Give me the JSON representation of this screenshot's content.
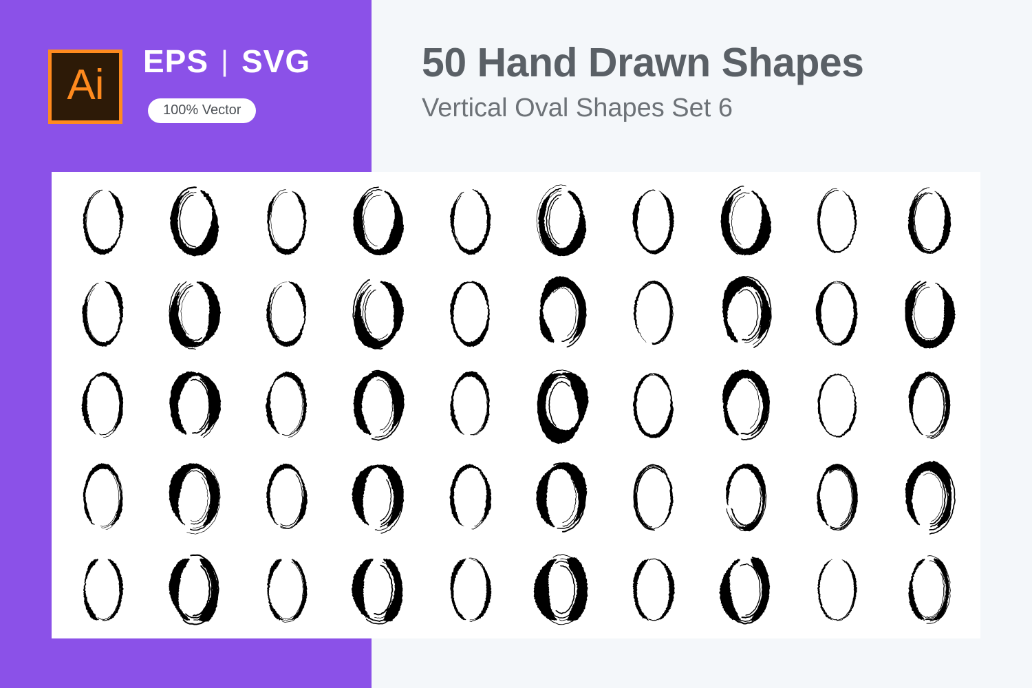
{
  "poster": {
    "colors": {
      "purple": "#8b51e8",
      "page_background": "#f4f7fa",
      "panel_background": "#ffffff",
      "title_gray": "#5a6066",
      "subtitle_gray": "#6d7277",
      "logo_orange": "#ff8a1e",
      "logo_dark": "#2d1a07",
      "shape_black": "#000000"
    }
  },
  "badge": {
    "logo_text": "Ai",
    "format_primary": "EPS",
    "format_separator": "|",
    "format_secondary": "SVG",
    "vector_pill": "100% Vector"
  },
  "heading": {
    "title": "50 Hand Drawn Shapes",
    "subtitle": "Vertical Oval Shapes Set 6"
  },
  "shapes": {
    "count": 50,
    "columns": 10,
    "rows": 5,
    "kind": "hand-drawn-brush-oval",
    "items": [
      {
        "id": 1,
        "style": "thin",
        "gap": "right",
        "tail": "light"
      },
      {
        "id": 2,
        "style": "bold",
        "gap": "right",
        "tail": "heavy"
      },
      {
        "id": 3,
        "style": "thin",
        "gap": "right",
        "tail": "wispy"
      },
      {
        "id": 4,
        "style": "bold",
        "gap": "right",
        "tail": "heavy"
      },
      {
        "id": 5,
        "style": "thin",
        "gap": "bottom-right",
        "tail": "wispy"
      },
      {
        "id": 6,
        "style": "bold",
        "gap": "right",
        "tail": "double"
      },
      {
        "id": 7,
        "style": "thin",
        "gap": "right",
        "tail": "light"
      },
      {
        "id": 8,
        "style": "bold",
        "gap": "right",
        "tail": "heavy"
      },
      {
        "id": 9,
        "style": "hairline",
        "gap": "right",
        "tail": "wispy"
      },
      {
        "id": 10,
        "style": "mixed",
        "gap": "right",
        "tail": "double"
      },
      {
        "id": 11,
        "style": "thin",
        "gap": "bottom-right",
        "tail": "wispy"
      },
      {
        "id": 12,
        "style": "bold",
        "gap": "bottom-right",
        "tail": "double"
      },
      {
        "id": 13,
        "style": "thin",
        "gap": "bottom-right",
        "tail": "wispy"
      },
      {
        "id": 14,
        "style": "bold",
        "gap": "bottom-right",
        "tail": "double"
      },
      {
        "id": 15,
        "style": "thin",
        "gap": "none",
        "tail": "light"
      },
      {
        "id": 16,
        "style": "bold",
        "gap": "left",
        "tail": "heavy"
      },
      {
        "id": 17,
        "style": "hairline",
        "gap": "bottom",
        "tail": "double"
      },
      {
        "id": 18,
        "style": "bold",
        "gap": "bottom",
        "tail": "double"
      },
      {
        "id": 19,
        "style": "thin",
        "gap": "none",
        "tail": "light"
      },
      {
        "id": 20,
        "style": "bold",
        "gap": "right",
        "tail": "heavy"
      },
      {
        "id": 21,
        "style": "thin",
        "gap": "left",
        "tail": "light"
      },
      {
        "id": 22,
        "style": "bold",
        "gap": "left",
        "tail": "heavy"
      },
      {
        "id": 23,
        "style": "thin",
        "gap": "left",
        "tail": "wispy"
      },
      {
        "id": 24,
        "style": "bold",
        "gap": "left",
        "tail": "heavy"
      },
      {
        "id": 25,
        "style": "thin",
        "gap": "left",
        "tail": "wispy"
      },
      {
        "id": 26,
        "style": "heavy-blob",
        "gap": "none",
        "tail": "heavy"
      },
      {
        "id": 27,
        "style": "thin",
        "gap": "none",
        "tail": "light"
      },
      {
        "id": 28,
        "style": "bold",
        "gap": "left",
        "tail": "heavy"
      },
      {
        "id": 29,
        "style": "hairline",
        "gap": "none",
        "tail": "light"
      },
      {
        "id": 30,
        "style": "mixed",
        "gap": "left",
        "tail": "double"
      },
      {
        "id": 31,
        "style": "thin",
        "gap": "bottom-left",
        "tail": "wispy"
      },
      {
        "id": 32,
        "style": "bold",
        "gap": "bottom-left",
        "tail": "double"
      },
      {
        "id": 33,
        "style": "thin",
        "gap": "bottom-left",
        "tail": "wispy"
      },
      {
        "id": 34,
        "style": "bold",
        "gap": "bottom-left",
        "tail": "double"
      },
      {
        "id": 35,
        "style": "thin",
        "gap": "bottom",
        "tail": "wispy"
      },
      {
        "id": 36,
        "style": "bold",
        "gap": "left",
        "tail": "heavy"
      },
      {
        "id": 37,
        "style": "hairline",
        "gap": "none",
        "tail": "double"
      },
      {
        "id": 38,
        "style": "mixed",
        "gap": "top-left",
        "tail": "double"
      },
      {
        "id": 39,
        "style": "thin",
        "gap": "bottom-left",
        "tail": "double"
      },
      {
        "id": 40,
        "style": "bold",
        "gap": "bottom-left",
        "tail": "double"
      },
      {
        "id": 41,
        "style": "thin",
        "gap": "sides",
        "tail": "light"
      },
      {
        "id": 42,
        "style": "bold",
        "gap": "sides",
        "tail": "heavy"
      },
      {
        "id": 43,
        "style": "thin",
        "gap": "sides",
        "tail": "wispy"
      },
      {
        "id": 44,
        "style": "bold",
        "gap": "sides",
        "tail": "heavy"
      },
      {
        "id": 45,
        "style": "thin",
        "gap": "sides",
        "tail": "light"
      },
      {
        "id": 46,
        "style": "heavy-blob",
        "gap": "sides",
        "tail": "heavy"
      },
      {
        "id": 47,
        "style": "thin",
        "gap": "sides",
        "tail": "light"
      },
      {
        "id": 48,
        "style": "bold",
        "gap": "sides",
        "tail": "heavy"
      },
      {
        "id": 49,
        "style": "hairline",
        "gap": "sides",
        "tail": "light"
      },
      {
        "id": 50,
        "style": "mixed",
        "gap": "sides",
        "tail": "double"
      }
    ]
  }
}
